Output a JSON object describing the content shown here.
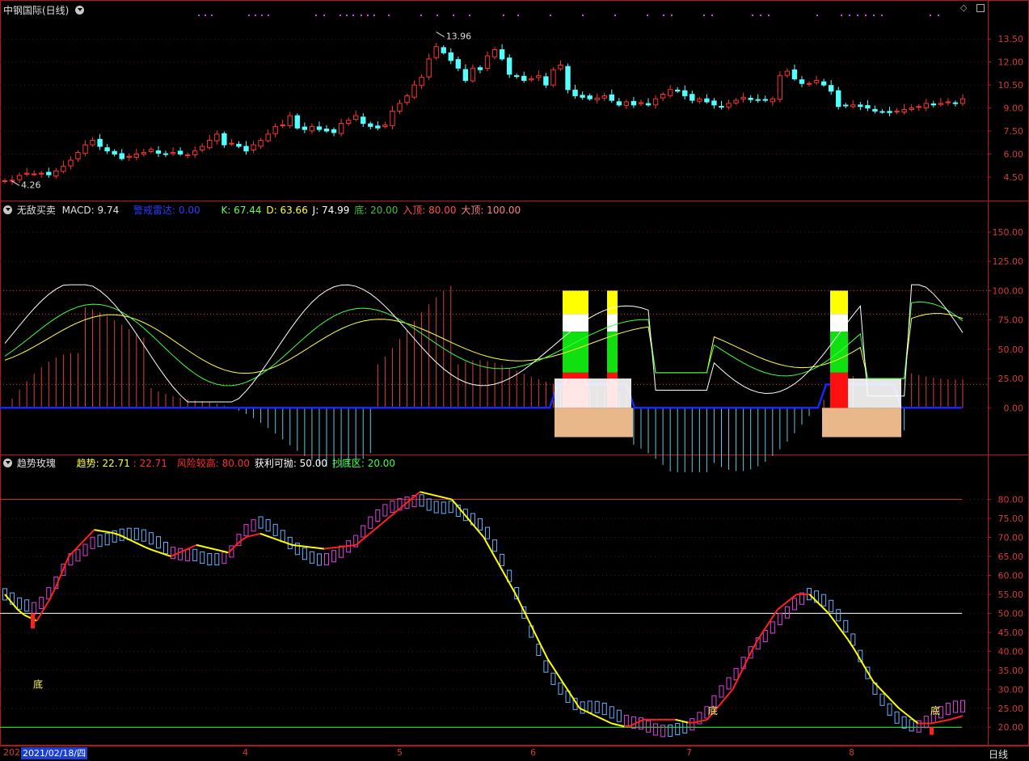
{
  "window": {
    "title": "中钢国际(日线)"
  },
  "price_panel": {
    "high_label": "13.96",
    "low_label": "4.26"
  },
  "indicator_panel": {
    "name": "无敌买卖",
    "macd_label": "MACD: 9.74",
    "radar_label": "警戒雷达: 0.00",
    "k_label": "K: 67.44",
    "d_label": "D: 63.66",
    "j_label": "J: 74.99",
    "bottom_label": "底: 20.00",
    "enter_top_label": "入顶: 80.00",
    "big_top_label": "大顶: 100.00"
  },
  "trend_panel": {
    "name": "趋势玫瑰",
    "trend_label": "趋势: 22.71",
    "trend_value2": ": 22.71",
    "risk_label": "风险较高: 80.00",
    "profit_label": "获利可抛: 50.00",
    "bottom_zone_label": "抄底区: 20.00",
    "bottom_marker": "底"
  },
  "footer": {
    "date_cursor": "2021/02/18/四",
    "year_prefix": "202",
    "period_label": "日线",
    "month_labels": [
      "4",
      "5",
      "6",
      "7",
      "8"
    ]
  },
  "colors": {
    "up": "#ff3232",
    "down": "#54ffff",
    "grid": "#7a1a1a",
    "axis": "#c02020",
    "kline": "#ffffff",
    "dline": "#ffff40",
    "jline": "#40ff40",
    "radar": "#1428ff",
    "trend_up": "#ff2020",
    "trend_down": "#ffff00",
    "bar_up": "#e040e0",
    "bar_down": "#66b0ff"
  },
  "chart_data": [
    {
      "type": "candlestick",
      "title": "中钢国际(日线)",
      "ylim": [
        3.6,
        15.2
      ],
      "y_ticks": [
        4.5,
        6.0,
        7.5,
        9.0,
        10.5,
        12.0,
        13.5
      ],
      "annotations": {
        "max": 13.96,
        "min": 4.26
      },
      "close": [
        4.26,
        4.3,
        4.6,
        4.75,
        4.7,
        4.75,
        4.65,
        4.9,
        5.2,
        5.6,
        6.1,
        6.6,
        6.9,
        6.5,
        6.2,
        6.0,
        5.7,
        5.85,
        6.0,
        6.1,
        6.3,
        6.05,
        6.0,
        6.1,
        6.0,
        5.95,
        6.2,
        6.5,
        6.9,
        7.3,
        6.6,
        6.7,
        6.5,
        6.2,
        6.6,
        6.9,
        7.3,
        7.8,
        7.9,
        8.5,
        7.7,
        7.6,
        7.8,
        7.6,
        7.5,
        7.4,
        8.0,
        8.2,
        8.5,
        8.0,
        7.8,
        7.7,
        7.9,
        8.8,
        9.3,
        9.8,
        10.5,
        11.0,
        12.2,
        13.0,
        12.6,
        12.1,
        11.6,
        10.8,
        11.6,
        11.5,
        12.4,
        12.8,
        12.2,
        11.2,
        11.1,
        10.8,
        10.9,
        11.1,
        10.5,
        11.5,
        11.8,
        10.2,
        9.8,
        9.7,
        9.6,
        9.65,
        9.8,
        9.5,
        9.2,
        9.4,
        9.2,
        9.35,
        9.2,
        9.6,
        9.9,
        10.2,
        10.1,
        9.8,
        9.5,
        9.6,
        9.4,
        9.2,
        9.1,
        9.3,
        9.5,
        9.7,
        9.55,
        9.5,
        9.5,
        9.6,
        11.1,
        11.4,
        10.9,
        10.6,
        10.6,
        10.8,
        10.5,
        10.1,
        9.1,
        9.15,
        9.2,
        9.1,
        9.0,
        8.8,
        8.75,
        8.7,
        8.8,
        8.9,
        9.0,
        9.1,
        9.3,
        9.2,
        9.3,
        9.4,
        9.3,
        9.6
      ]
    },
    {
      "type": "bar+line",
      "title": "无敌买卖",
      "ylim": [
        -35,
        170
      ],
      "y_ticks": [
        0,
        25,
        50,
        75,
        100,
        125,
        150
      ],
      "reference_lines": [
        20,
        80,
        100
      ],
      "series": [
        {
          "name": "K",
          "last": 67.44
        },
        {
          "name": "D",
          "last": 63.66
        },
        {
          "name": "J",
          "last": 74.99
        },
        {
          "name": "MACD",
          "last": 9.74
        },
        {
          "name": "警戒雷达",
          "last": 0.0
        }
      ]
    },
    {
      "type": "line+bar",
      "title": "趋势玫瑰",
      "ylim": [
        16,
        88
      ],
      "y_ticks": [
        20,
        25,
        30,
        35,
        40,
        45,
        50,
        55,
        60,
        65,
        70,
        75,
        80
      ],
      "reference_lines": [
        80,
        50,
        20
      ],
      "series": [
        {
          "name": "趋势",
          "last": 22.71
        }
      ],
      "trend_points": [
        [
          0,
          55
        ],
        [
          5,
          50
        ],
        [
          10,
          48
        ],
        [
          15,
          55
        ],
        [
          20,
          65
        ],
        [
          28,
          72
        ],
        [
          35,
          71
        ],
        [
          45,
          67
        ],
        [
          52,
          65
        ],
        [
          60,
          68
        ],
        [
          70,
          66
        ],
        [
          75,
          70
        ],
        [
          80,
          71
        ],
        [
          90,
          68
        ],
        [
          100,
          67
        ],
        [
          110,
          68
        ],
        [
          120,
          75
        ],
        [
          130,
          82
        ],
        [
          140,
          80
        ],
        [
          150,
          70
        ],
        [
          160,
          55
        ],
        [
          170,
          38
        ],
        [
          180,
          25
        ],
        [
          190,
          21
        ],
        [
          195,
          20
        ],
        [
          200,
          22
        ],
        [
          210,
          22
        ],
        [
          215,
          21
        ],
        [
          220,
          22
        ],
        [
          228,
          30
        ],
        [
          235,
          42
        ],
        [
          242,
          51
        ],
        [
          248,
          55
        ],
        [
          252,
          55
        ],
        [
          258,
          50
        ],
        [
          265,
          42
        ],
        [
          272,
          32
        ],
        [
          280,
          25
        ],
        [
          286,
          21
        ],
        [
          290,
          21
        ],
        [
          296,
          22
        ],
        [
          300,
          23
        ]
      ]
    }
  ]
}
